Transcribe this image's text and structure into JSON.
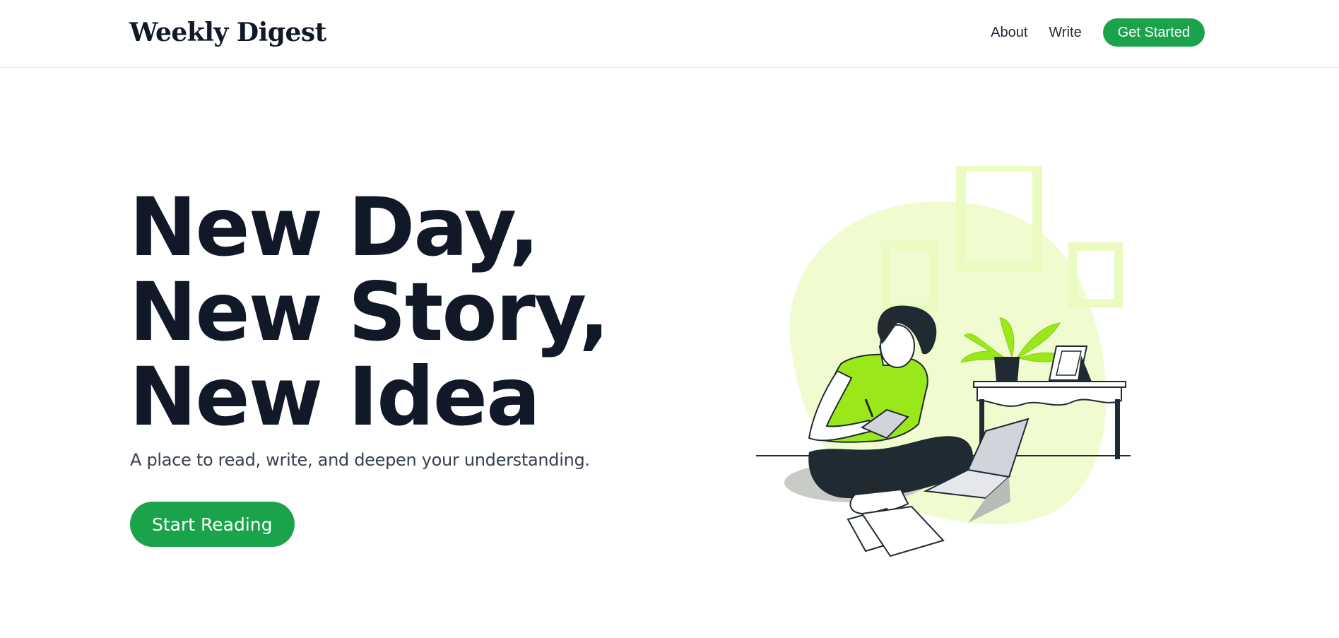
{
  "header": {
    "brand": "Weekly Digest",
    "nav": {
      "about": "About",
      "write": "Write",
      "get_started": "Get Started"
    }
  },
  "hero": {
    "title_lines": [
      "New Day,",
      "New Story,",
      "New Idea"
    ],
    "subtitle": "A place to read, write, and deepen your understanding.",
    "cta": "Start Reading"
  },
  "illustration": {
    "subject": "woman-writing-in-notebook-illustration",
    "colors": {
      "accent_green": "#1aa34a",
      "lime": "#9be81a",
      "pale_lime": "#f0fccf",
      "dark": "#1f2a33"
    }
  }
}
